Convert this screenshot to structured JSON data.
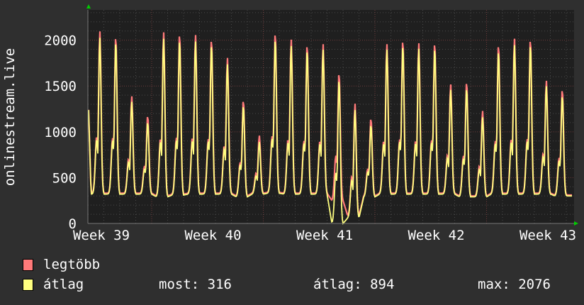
{
  "chart_data": {
    "type": "line",
    "ylabel": "onlinestream.live",
    "ylim": [
      0,
      2330
    ],
    "yticks": [
      "0",
      "500",
      "1000",
      "1500",
      "2000"
    ],
    "ytick_values": [
      0,
      500,
      1000,
      1500,
      2000
    ],
    "xticks": [
      "Week 39",
      "Week 40",
      "Week 41",
      "Week 42",
      "Week 43"
    ],
    "days": 30.5,
    "grid": true,
    "series": [
      {
        "name": "legtöbb",
        "color": "#ff7a7a",
        "daily_peak": [
          2100,
          2050,
          1390,
          1180,
          2090,
          2080,
          2060,
          2020,
          1810,
          1350,
          960,
          2090,
          2010,
          1960,
          1960,
          1650,
          1310,
          1150,
          1960,
          2010,
          1970,
          1980,
          1520,
          1550,
          1230,
          1960,
          2020,
          2020,
          1560,
          1470
        ],
        "daily_trough": [
          330,
          330,
          330,
          330,
          300,
          320,
          330,
          330,
          330,
          300,
          330,
          340,
          330,
          330,
          330,
          250,
          80,
          300,
          330,
          330,
          330,
          330,
          330,
          300,
          300,
          330,
          330,
          330,
          330,
          310
        ]
      },
      {
        "name": "átlag",
        "color": "#ffff80",
        "daily_peak": [
          2030,
          1990,
          1330,
          1110,
          2020,
          2010,
          1990,
          1960,
          1740,
          1290,
          890,
          2020,
          1940,
          1900,
          1900,
          1580,
          1240,
          1080,
          1900,
          1950,
          1910,
          1920,
          1460,
          1480,
          1160,
          1890,
          1950,
          1960,
          1500,
          1400
        ],
        "daily_trough": [
          320,
          320,
          320,
          320,
          290,
          310,
          320,
          320,
          320,
          290,
          320,
          330,
          320,
          320,
          320,
          0,
          60,
          290,
          320,
          320,
          320,
          320,
          320,
          290,
          290,
          320,
          320,
          320,
          320,
          300
        ]
      }
    ]
  },
  "legend": {
    "max_label": "legtöbb",
    "avg_label": "átlag",
    "now": "most: 316",
    "avg": "átlag: 894",
    "max": "max: 2076"
  }
}
